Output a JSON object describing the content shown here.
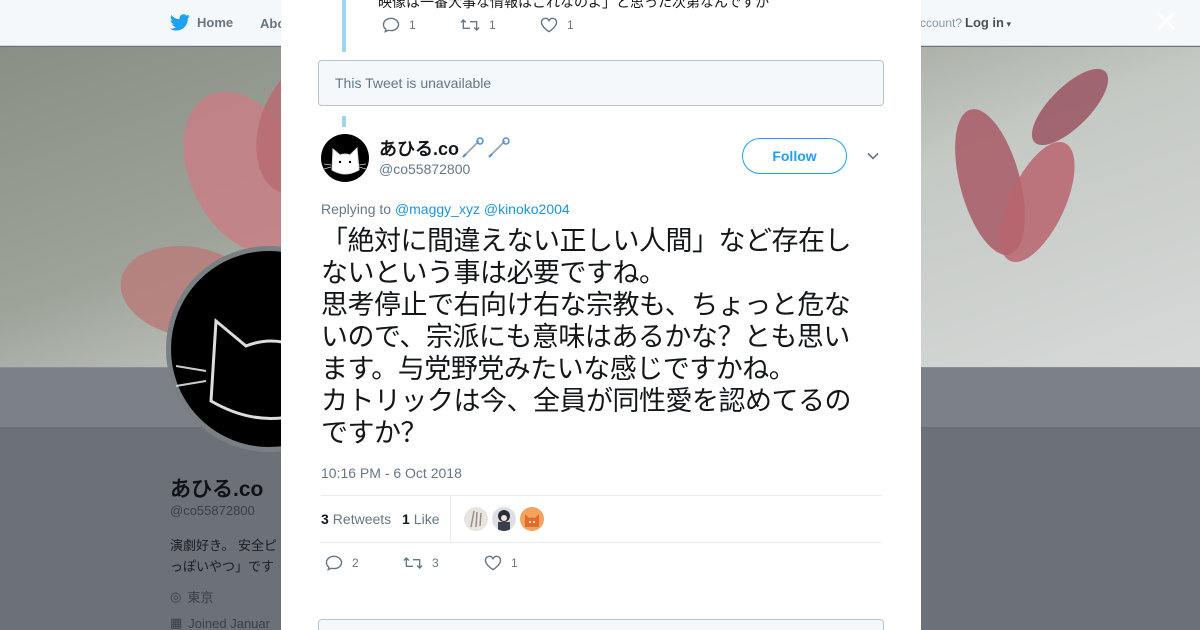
{
  "nav": {
    "home": "Home",
    "about": "Abo",
    "account_prompt": "ccount?",
    "login": "Log in"
  },
  "profile_bg": {
    "name": "あひる.co",
    "handle": "@co55872800",
    "bio_line1": "演劇好き。 安全ピ",
    "bio_line2": "っぽいやつ」です",
    "location": "東京",
    "joined": "Joined Januar"
  },
  "previous_tweet": {
    "cut_text": "映像は一番大事な情報はこれなのよ」と思った次第なんですが",
    "replies": "1",
    "retweets": "1",
    "likes": "1"
  },
  "unavailable_notice": "This Tweet is unavailable",
  "tweet": {
    "author_name": "あひる.co",
    "author_handle": "@co55872800",
    "follow_label": "Follow",
    "replying_prefix": "Replying to",
    "replying_to": [
      "@maggy_xyz",
      "@kinoko2004"
    ],
    "text_lines": [
      "「絶対に間違えない正しい人間」など存在し",
      "ないという事は必要ですね。",
      "思考停止で右向け右な宗教も、ちょっと危な",
      "いので、宗派にも意味はあるかな？とも思い",
      "ます。与党野党みたいな感じですかね。",
      "カトリックは今、全員が同性愛を認めてるの",
      "ですか？"
    ],
    "timestamp": "10:16 PM - 6 Oct 2018",
    "retweet_count": "3",
    "retweet_label": "Retweets",
    "like_count": "1",
    "like_label": "Like",
    "replies": "2",
    "retweets": "3",
    "likes": "1"
  },
  "colors": {
    "accent": "#1da1f2",
    "link": "#1b95e0",
    "muted": "#657786",
    "thread_line": "#9fd6ef"
  },
  "icons": {
    "brand": "twitter-bird-icon",
    "reply": "reply-icon",
    "retweet": "retweet-icon",
    "like": "heart-icon",
    "close": "close-icon",
    "caret": "chevron-down-icon",
    "pin": "safety-pin-icon"
  }
}
